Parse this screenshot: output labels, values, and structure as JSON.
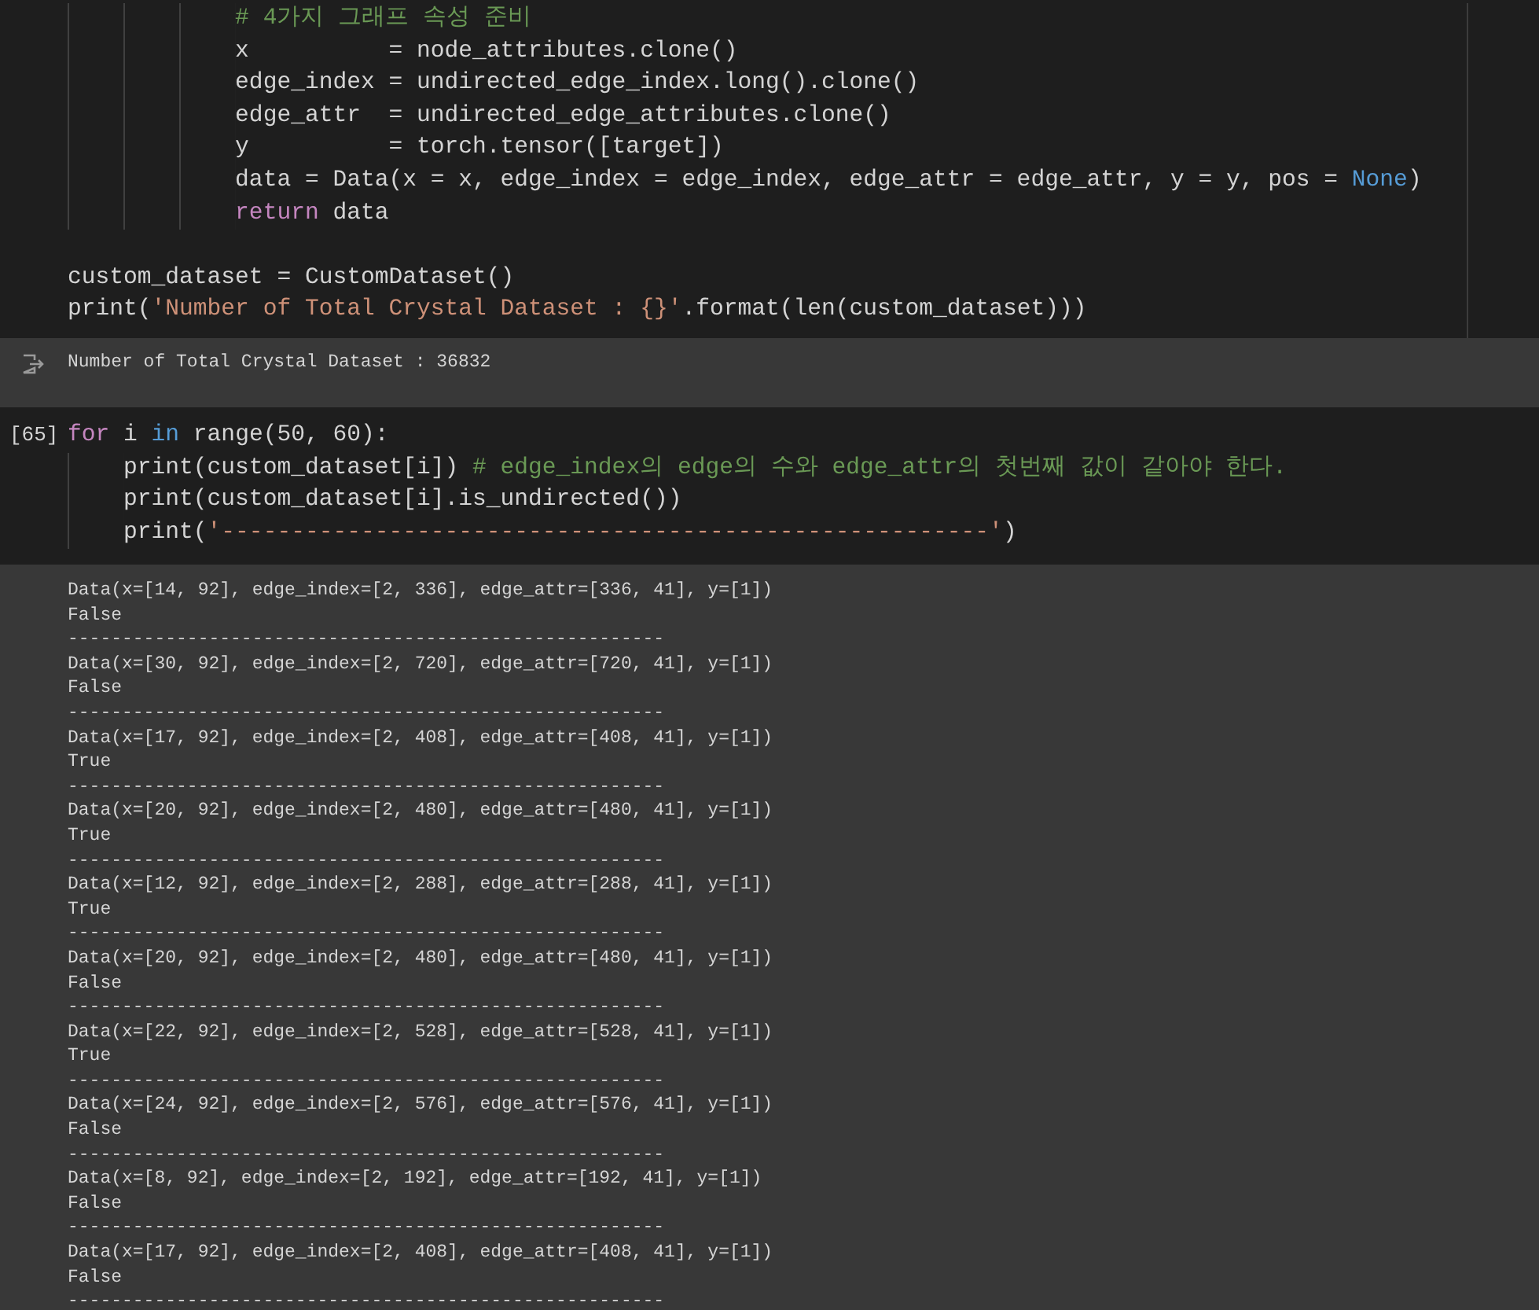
{
  "cell_1": {
    "lines": [
      {
        "tokens": [
          {
            "kind": "comment",
            "text": "            # 4가지 그래프 속성 준비"
          }
        ]
      },
      {
        "tokens": [
          {
            "kind": "plain",
            "text": "            x          = node_attributes.clone()"
          }
        ]
      },
      {
        "tokens": [
          {
            "kind": "plain",
            "text": "            edge_index = undirected_edge_index.long().clone()"
          }
        ]
      },
      {
        "tokens": [
          {
            "kind": "plain",
            "text": "            edge_attr  = undirected_edge_attributes.clone()"
          }
        ]
      },
      {
        "tokens": [
          {
            "kind": "plain",
            "text": "            y          = torch.tensor([target])"
          }
        ]
      },
      {
        "tokens": [
          {
            "kind": "plain",
            "text": "            data = Data(x = x, edge_index = edge_index, edge_attr = edge_attr, y = y, pos = "
          },
          {
            "kind": "constant",
            "text": "None"
          },
          {
            "kind": "plain",
            "text": ")"
          }
        ]
      },
      {
        "tokens": [
          {
            "kind": "keyword",
            "text": "            return"
          },
          {
            "kind": "plain",
            "text": " data"
          }
        ]
      },
      {
        "blank_before": true,
        "tokens": [
          {
            "kind": "plain",
            "text": "custom_dataset = CustomDataset()"
          }
        ]
      },
      {
        "tokens": [
          {
            "kind": "plain",
            "text": "print("
          },
          {
            "kind": "string",
            "text": "'Number of Total Crystal Dataset : {}'"
          },
          {
            "kind": "plain",
            "text": ".format(len(custom_dataset)))"
          }
        ]
      }
    ]
  },
  "output_1": {
    "lines": [
      "Number of Total Crystal Dataset : 36832"
    ]
  },
  "cell_2": {
    "execution_count": "[65]",
    "lines": [
      {
        "tokens": [
          {
            "kind": "keyword",
            "text": "for"
          },
          {
            "kind": "plain",
            "text": " i "
          },
          {
            "kind": "operator",
            "text": "in"
          },
          {
            "kind": "plain",
            "text": " range(50, 60):"
          }
        ]
      },
      {
        "tokens": [
          {
            "kind": "plain",
            "text": "    print(custom_dataset[i]) "
          },
          {
            "kind": "comment",
            "text": "# edge_index의 edge의 수와 edge_attr의 첫번째 값이 같아야 한다."
          }
        ]
      },
      {
        "tokens": [
          {
            "kind": "plain",
            "text": "    print(custom_dataset[i].is_undirected())"
          }
        ]
      },
      {
        "tokens": [
          {
            "kind": "plain",
            "text": "    print("
          },
          {
            "kind": "string",
            "text": "'-------------------------------------------------------'"
          },
          {
            "kind": "plain",
            "text": ")"
          }
        ]
      }
    ]
  },
  "output_2": {
    "lines": [
      "Data(x=[14, 92], edge_index=[2, 336], edge_attr=[336, 41], y=[1])",
      "False",
      "-------------------------------------------------------",
      "Data(x=[30, 92], edge_index=[2, 720], edge_attr=[720, 41], y=[1])",
      "False",
      "-------------------------------------------------------",
      "Data(x=[17, 92], edge_index=[2, 408], edge_attr=[408, 41], y=[1])",
      "True",
      "-------------------------------------------------------",
      "Data(x=[20, 92], edge_index=[2, 480], edge_attr=[480, 41], y=[1])",
      "True",
      "-------------------------------------------------------",
      "Data(x=[12, 92], edge_index=[2, 288], edge_attr=[288, 41], y=[1])",
      "True",
      "-------------------------------------------------------",
      "Data(x=[20, 92], edge_index=[2, 480], edge_attr=[480, 41], y=[1])",
      "False",
      "-------------------------------------------------------",
      "Data(x=[22, 92], edge_index=[2, 528], edge_attr=[528, 41], y=[1])",
      "True",
      "-------------------------------------------------------",
      "Data(x=[24, 92], edge_index=[2, 576], edge_attr=[576, 41], y=[1])",
      "False",
      "-------------------------------------------------------",
      "Data(x=[8, 92], edge_index=[2, 192], edge_attr=[192, 41], y=[1])",
      "False",
      "-------------------------------------------------------",
      "Data(x=[17, 92], edge_index=[2, 408], edge_attr=[408, 41], y=[1])",
      "False",
      "-------------------------------------------------------"
    ]
  }
}
